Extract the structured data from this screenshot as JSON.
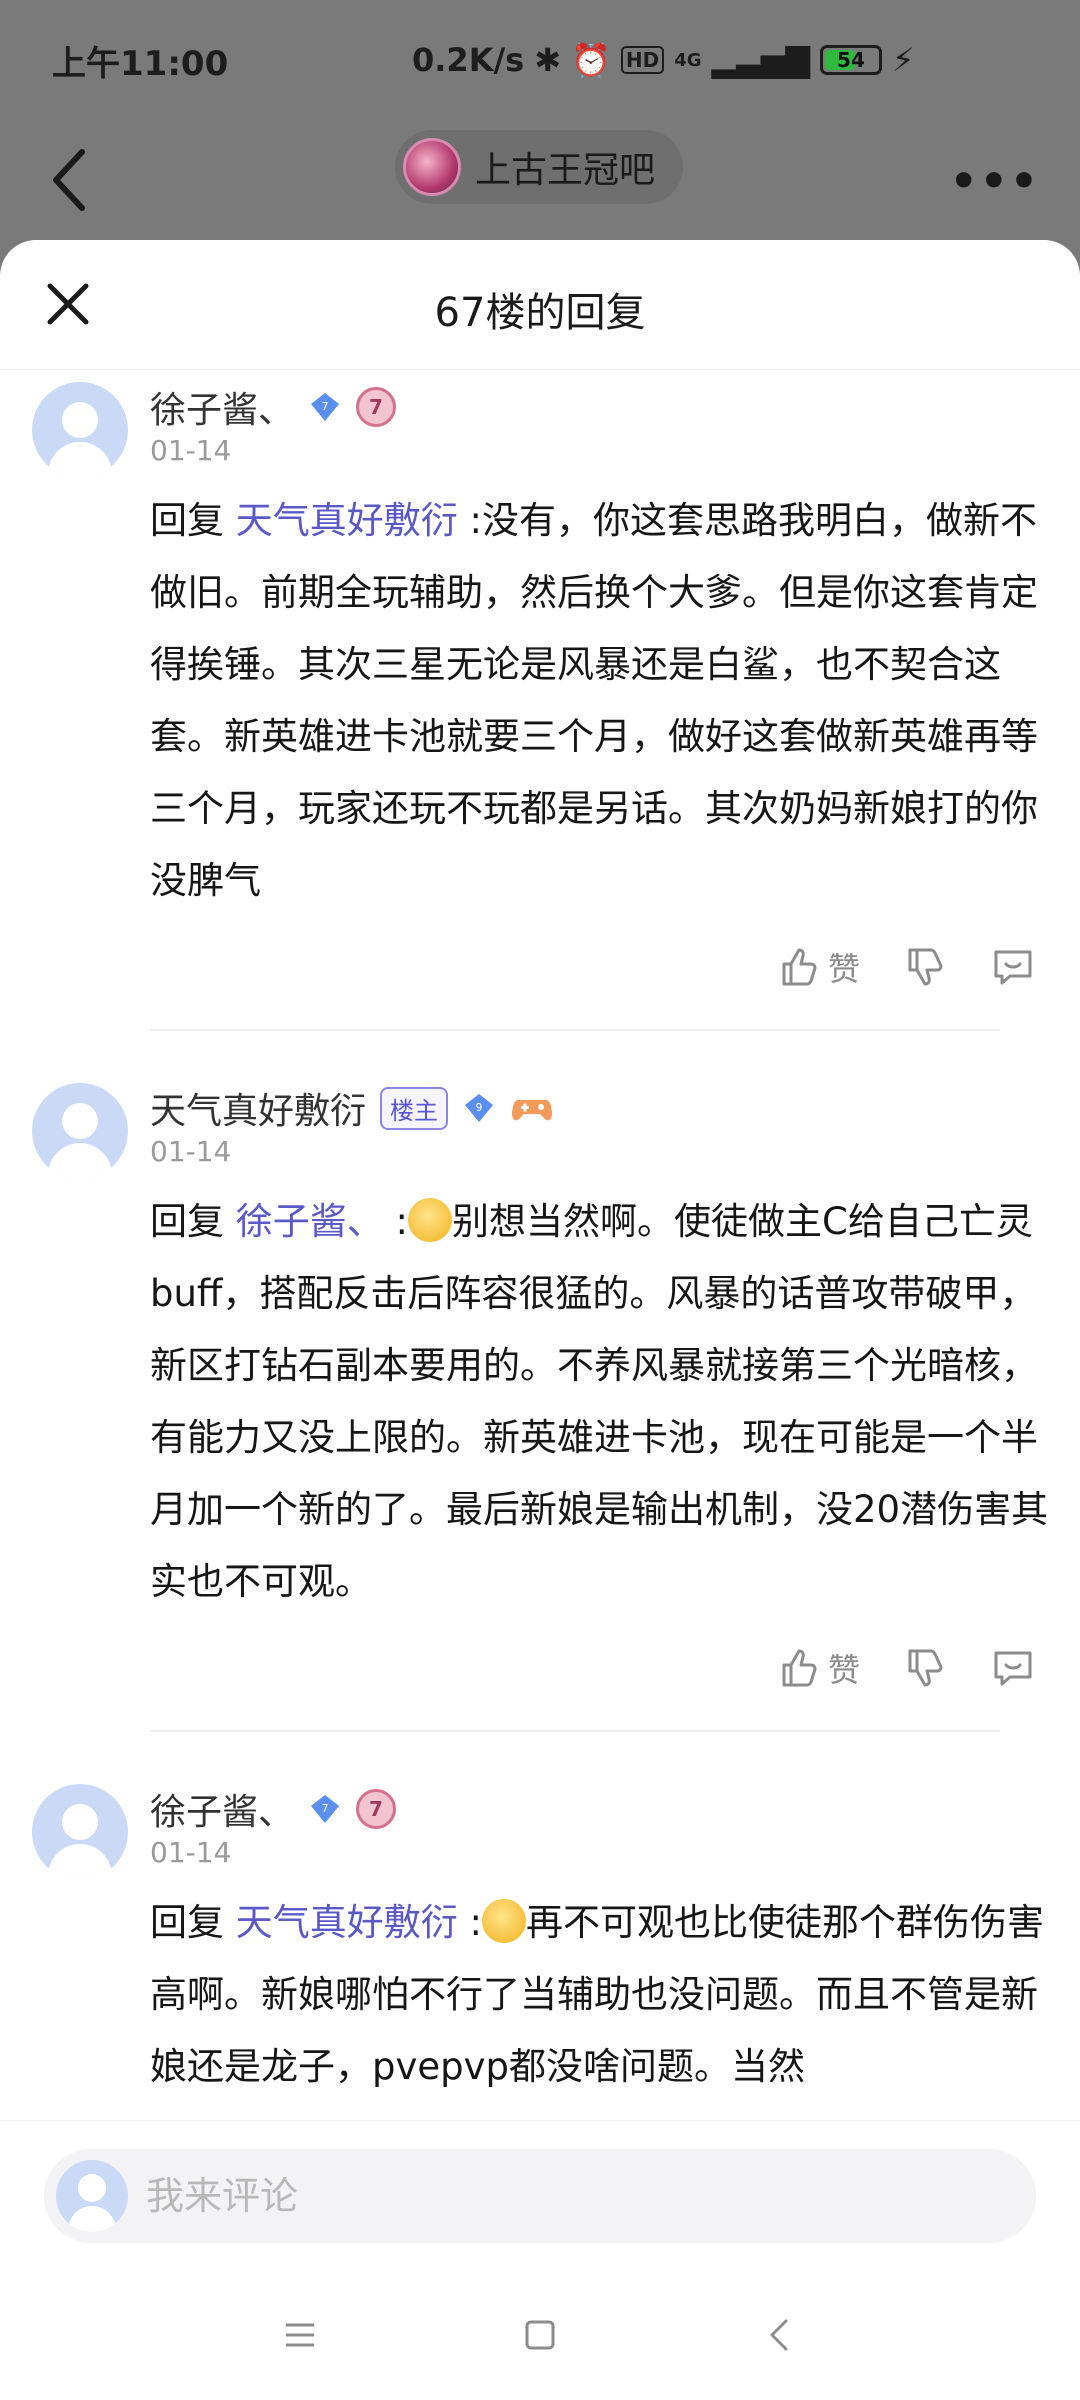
{
  "status": {
    "time": "上午11:00",
    "speed": "0.2K/s",
    "network": "4G",
    "battery": "54"
  },
  "header": {
    "forum_name": "上古王冠吧"
  },
  "sheet": {
    "title": "67楼的回复"
  },
  "comments": [
    {
      "user": "徐子酱、",
      "level": "7",
      "date": "01-14",
      "reply_prefix": "回复",
      "reply_to": "天气真好敷衍",
      "text": ":没有，你这套思路我明白，做新不做旧。前期全玩辅助，然后换个大爹。但是你这套肯定得挨锤。其次三星无论是风暴还是白鲨，也不契合这套。新英雄进卡池就要三个月，做好这套做新英雄再等三个月，玩家还玩不玩都是另话。其次奶妈新娘打的你没脾气",
      "like_label": "赞"
    },
    {
      "user": "天气真好敷衍",
      "host_badge": "楼主",
      "level": "9",
      "date": "01-14",
      "reply_prefix": "回复",
      "reply_to": "徐子酱、",
      "colon": ":",
      "text": "别想当然啊。使徒做主C给自己亡灵buff，搭配反击后阵容很猛的。风暴的话普攻带破甲，新区打钻石副本要用的。不养风暴就接第三个光暗核，有能力又没上限的。新英雄进卡池，现在可能是一个半月加一个新的了。最后新娘是输出机制，没20潜伤害其实也不可观。",
      "like_label": "赞"
    },
    {
      "user": "徐子酱、",
      "level": "7",
      "date": "01-14",
      "reply_prefix": "回复",
      "reply_to": "天气真好敷衍",
      "colon": ":",
      "text": "再不可观也比使徒那个群伤伤害高啊。新娘哪怕不行了当辅助也没问题。而且不管是新娘还是龙子，pvepvp都没啥问题。当然"
    }
  ],
  "input": {
    "placeholder": "我来评论"
  },
  "icons": {
    "back": "back-arrow-icon",
    "more": "more-dots-icon",
    "close": "close-icon",
    "like": "thumb-up-icon",
    "dislike": "thumb-down-icon",
    "reply": "comment-bubble-icon"
  }
}
